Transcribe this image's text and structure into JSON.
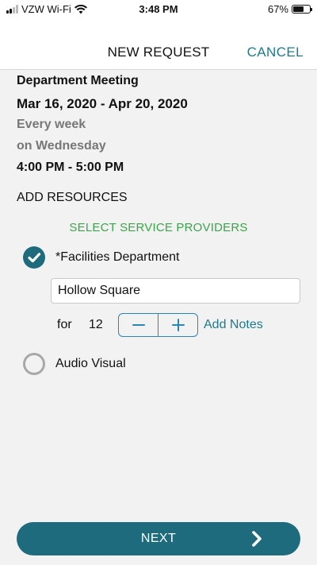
{
  "status_bar": {
    "carrier": "VZW Wi-Fi",
    "time": "3:48 PM",
    "battery_percent": "67%",
    "battery_level": 0.67
  },
  "nav": {
    "title": "NEW REQUEST",
    "cancel_label": "CANCEL"
  },
  "event": {
    "name": "Department Meeting",
    "date_range": "Mar 16, 2020 - Apr 20, 2020",
    "recurrence": "Every week",
    "recurrence_day": "on Wednesday",
    "time_range": "4:00 PM - 5:00 PM"
  },
  "resources": {
    "section_title": "ADD RESOURCES",
    "select_label": "SELECT SERVICE PROVIDERS",
    "providers": [
      {
        "label": "*Facilities Department",
        "selected": true,
        "setup_value": "Hollow Square",
        "for_label": "for",
        "quantity": "12",
        "add_notes_label": "Add Notes"
      },
      {
        "label": "Audio Visual",
        "selected": false
      }
    ]
  },
  "footer": {
    "next_label": "NEXT"
  },
  "colors": {
    "accent": "#1e6b7d",
    "link": "#1e7a8c",
    "green": "#3aa54a",
    "stepper_border": "#2a86b7"
  }
}
